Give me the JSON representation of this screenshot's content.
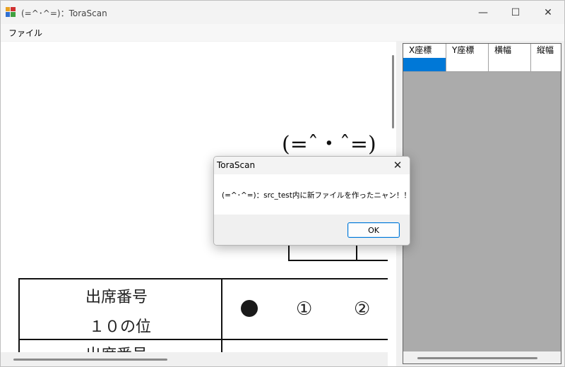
{
  "window": {
    "title": "(=^･^=)：ToraScan",
    "controls": {
      "minimize": "—",
      "maximize": "☐",
      "close": "✕"
    }
  },
  "menu": {
    "items": [
      {
        "label": "ファイル"
      }
    ]
  },
  "scan": {
    "kaomoji": "(=ˆ・ˆ=)",
    "row1_label_line1": "出席番号",
    "row1_label_line2": "１０の位",
    "row2_label": "出席番号",
    "bubbles": [
      "①",
      "②"
    ]
  },
  "grid": {
    "columns": [
      "X座標",
      "Y座標",
      "横幅",
      "縦幅"
    ],
    "rows": [
      [
        "",
        "",
        "",
        ""
      ]
    ],
    "selection_color": "#0078d7"
  },
  "dialog": {
    "title": "ToraScan",
    "message": "(=^･^=)：src_test内に新ファイルを作ったニャン！！",
    "ok_label": "OK",
    "close_glyph": "✕"
  }
}
